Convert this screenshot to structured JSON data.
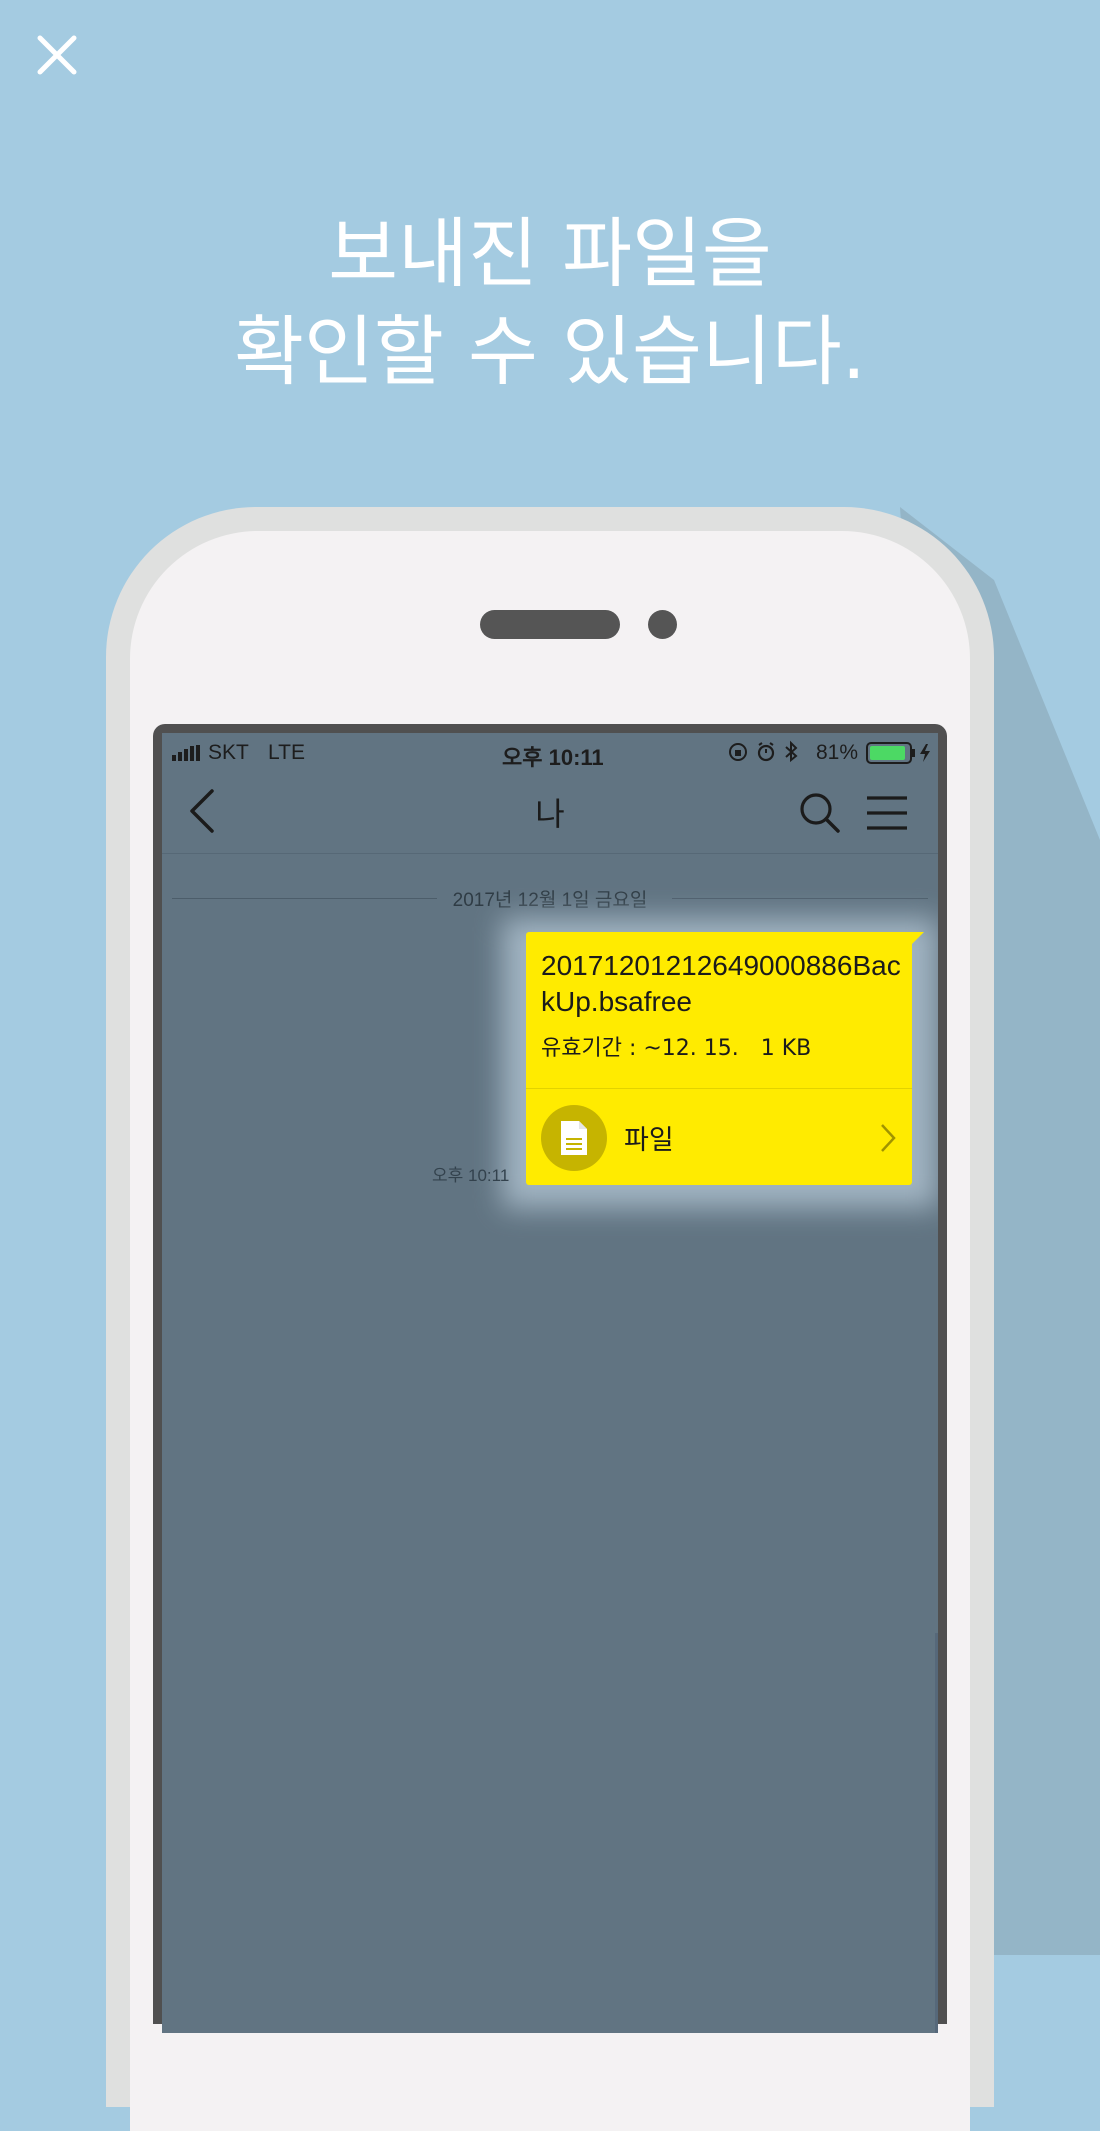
{
  "close_label": "X",
  "headline": {
    "line1": "보내진 파일을",
    "line2": "확인할 수 있습니다."
  },
  "status_bar": {
    "carrier": "SKT",
    "network": "LTE",
    "time": "오후 10:11",
    "battery": "81%"
  },
  "nav": {
    "title": "나"
  },
  "chat": {
    "date_separator": "2017년 12월 1일 금요일",
    "message": {
      "file_name": "20171201212649000886BackUp.bsafree",
      "expiry": "유효기간 : ~12. 15.",
      "size": "1 KB",
      "file_label": "파일",
      "time": "오후 10:11"
    }
  },
  "colors": {
    "background": "#a4cbe1",
    "screen": "#617482",
    "bubble": "#ffeb00",
    "battery": "#4cd964"
  },
  "icons": [
    "close-icon",
    "back-icon",
    "search-icon",
    "menu-icon",
    "file-icon",
    "chevron-right-icon",
    "alarm-icon",
    "bluetooth-icon",
    "lock-rotation-icon",
    "charging-icon",
    "signal-icon"
  ]
}
